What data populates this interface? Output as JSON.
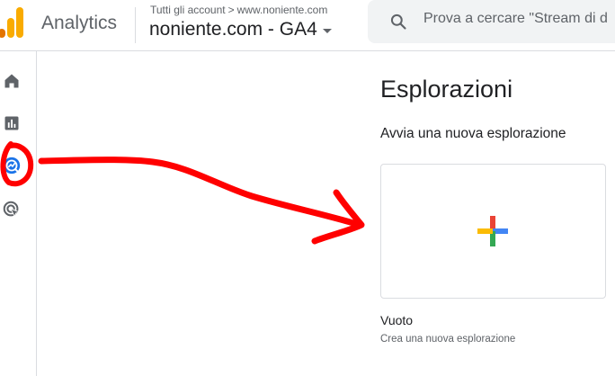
{
  "header": {
    "app_name": "Analytics",
    "breadcrumb": {
      "parent": "Tutti gli account",
      "separator": ">",
      "account": "www.noniente.com"
    },
    "property_name": "noniente.com - GA4",
    "search_placeholder": "Prova a cercare \"Stream di d"
  },
  "sidebar": {
    "items": [
      {
        "name": "home",
        "icon": "home-icon"
      },
      {
        "name": "reports",
        "icon": "bar-chart-icon"
      },
      {
        "name": "explore",
        "icon": "explore-icon",
        "active": true
      },
      {
        "name": "advertising",
        "icon": "advertising-icon"
      }
    ]
  },
  "main": {
    "title": "Esplorazioni",
    "subtitle": "Avvia una nuova esplorazione",
    "templates": [
      {
        "label": "Vuoto",
        "description": "Crea una nuova esplorazione",
        "icon": "plus-icon"
      }
    ]
  },
  "colors": {
    "annotation_red": "#ff0000",
    "active_blue": "#1a73e8",
    "logo_orange": "#f9ab00",
    "logo_dark_orange": "#e37400",
    "google_blue": "#4285f4",
    "google_red": "#ea4335",
    "google_yellow": "#fbbc04",
    "google_green": "#34a853"
  }
}
